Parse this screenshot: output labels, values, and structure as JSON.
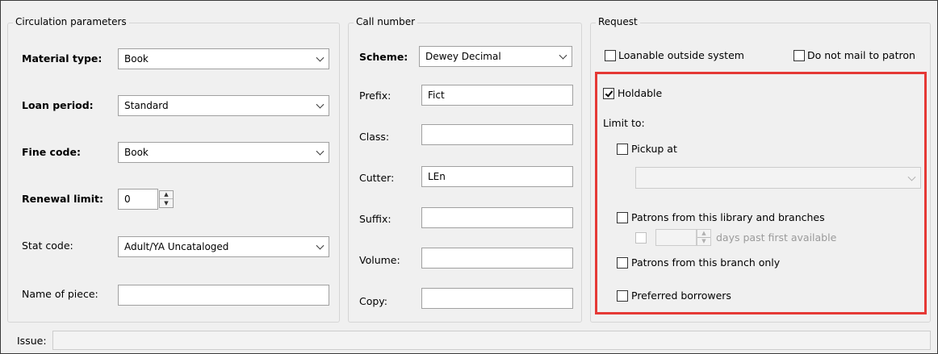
{
  "circulation": {
    "title": "Circulation parameters",
    "material_type": {
      "label": "Material type:",
      "value": "Book"
    },
    "loan_period": {
      "label": "Loan period:",
      "value": "Standard"
    },
    "fine_code": {
      "label": "Fine code:",
      "value": "Book"
    },
    "renewal_limit": {
      "label": "Renewal limit:",
      "value": "0"
    },
    "stat_code": {
      "label": "Stat code:",
      "value": "Adult/YA Uncataloged"
    },
    "name_of_piece": {
      "label": "Name of piece:",
      "value": ""
    }
  },
  "call_number": {
    "title": "Call number",
    "scheme": {
      "label": "Scheme:",
      "value": "Dewey Decimal"
    },
    "prefix": {
      "label": "Prefix:",
      "value": "Fict"
    },
    "class": {
      "label": "Class:",
      "value": ""
    },
    "cutter": {
      "label": "Cutter:",
      "value": "LEn"
    },
    "suffix": {
      "label": "Suffix:",
      "value": ""
    },
    "volume": {
      "label": "Volume:",
      "value": ""
    },
    "copy": {
      "label": "Copy:",
      "value": ""
    }
  },
  "request": {
    "title": "Request",
    "loanable_outside_system": {
      "label": "Loanable outside system",
      "checked": false
    },
    "do_not_mail": {
      "label": "Do not mail to patron",
      "checked": false
    },
    "holdable": {
      "label": "Holdable",
      "checked": true
    },
    "limit_to_label": "Limit to:",
    "pickup_at": {
      "label": "Pickup at",
      "checked": false,
      "value": ""
    },
    "patrons_library_branches": {
      "label": "Patrons from this library and branches",
      "checked": false
    },
    "days_past": {
      "checked": false,
      "value": "",
      "label": "days past first available"
    },
    "patrons_branch_only": {
      "label": "Patrons from this branch only",
      "checked": false
    },
    "preferred_borrowers": {
      "label": "Preferred borrowers",
      "checked": false
    }
  },
  "issue": {
    "label": "Issue:",
    "value": ""
  },
  "colors": {
    "highlight": "#e53935"
  }
}
